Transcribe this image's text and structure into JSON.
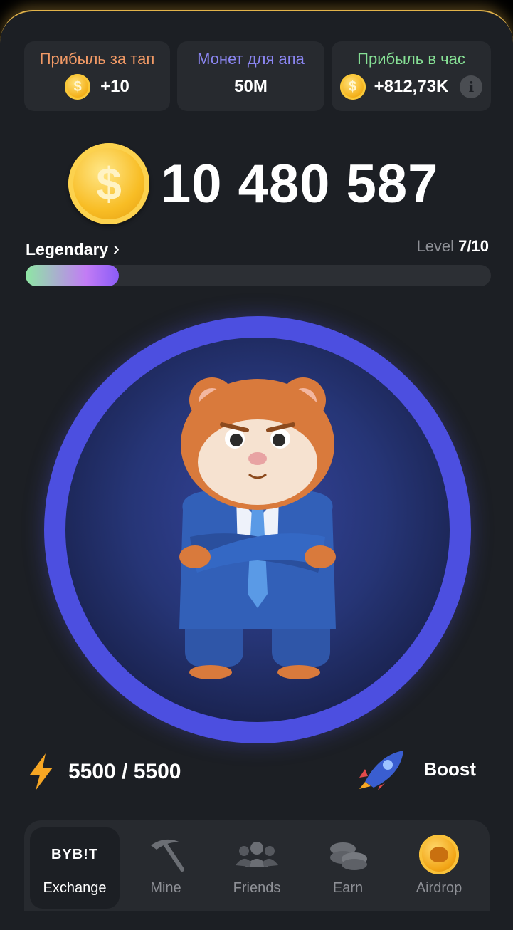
{
  "stats": [
    {
      "label": "Прибыль за тап",
      "value": "+10",
      "label_color": "#f29a66",
      "has_coin": true
    },
    {
      "label": "Монет для апа",
      "value": "50M",
      "label_color": "#8b86f2",
      "has_coin": false
    },
    {
      "label": "Прибыль в час",
      "value": "+812,73K",
      "label_color": "#86e095",
      "has_coin": true
    }
  ],
  "balance": "10 480 587",
  "rank": {
    "label": "Legendary",
    "chevron": "›"
  },
  "level": {
    "prefix": "Level",
    "value": "7/10"
  },
  "progress": {
    "fraction": 0.2
  },
  "energy": {
    "value": "5500 / 5500",
    "icon": "lightning-icon"
  },
  "boost": {
    "label": "Boost",
    "icon": "rocket-icon"
  },
  "nav": [
    {
      "label": "Exchange",
      "icon": "bybit-logo",
      "logo_text": "BYB!T",
      "active": true
    },
    {
      "label": "Mine",
      "icon": "pickaxe-icon",
      "active": false
    },
    {
      "label": "Friends",
      "icon": "friends-icon",
      "active": false
    },
    {
      "label": "Earn",
      "icon": "coins-stack-icon",
      "active": false
    },
    {
      "label": "Airdrop",
      "icon": "airdrop-coin-icon",
      "active": false
    }
  ],
  "colors": {
    "background": "#1c1f24",
    "card": "#272a2f",
    "accent_gold": "#f8bd25",
    "ring": "#4c4fe0"
  }
}
